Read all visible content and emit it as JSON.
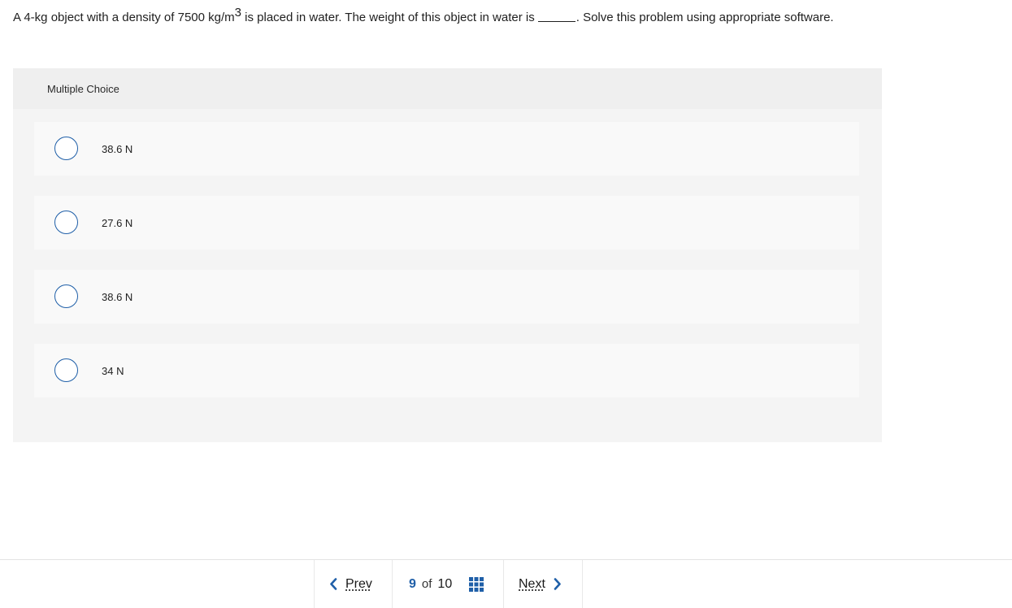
{
  "question": {
    "part1": "A 4-kg object with a density of 7500 kg/m",
    "superscript": "3",
    "part2": " is placed in water. The weight of this object in water is",
    "part3": ". Solve this problem using appropriate software."
  },
  "panel": {
    "header": "Multiple Choice",
    "options": [
      {
        "label": "38.6 N"
      },
      {
        "label": "27.6 N"
      },
      {
        "label": "38.6 N"
      },
      {
        "label": "34 N"
      }
    ]
  },
  "footer": {
    "prev_label": "Prev",
    "current_page": "9",
    "of_label": "of",
    "total_pages": "10",
    "next_label": "Next"
  },
  "colors": {
    "accent": "#1f5fa8",
    "panel_bg": "#f4f4f4",
    "option_bg": "#f9f9f9"
  },
  "icons": {
    "prev": "chevron-left-icon",
    "next": "chevron-right-icon",
    "overview": "grid-icon"
  }
}
